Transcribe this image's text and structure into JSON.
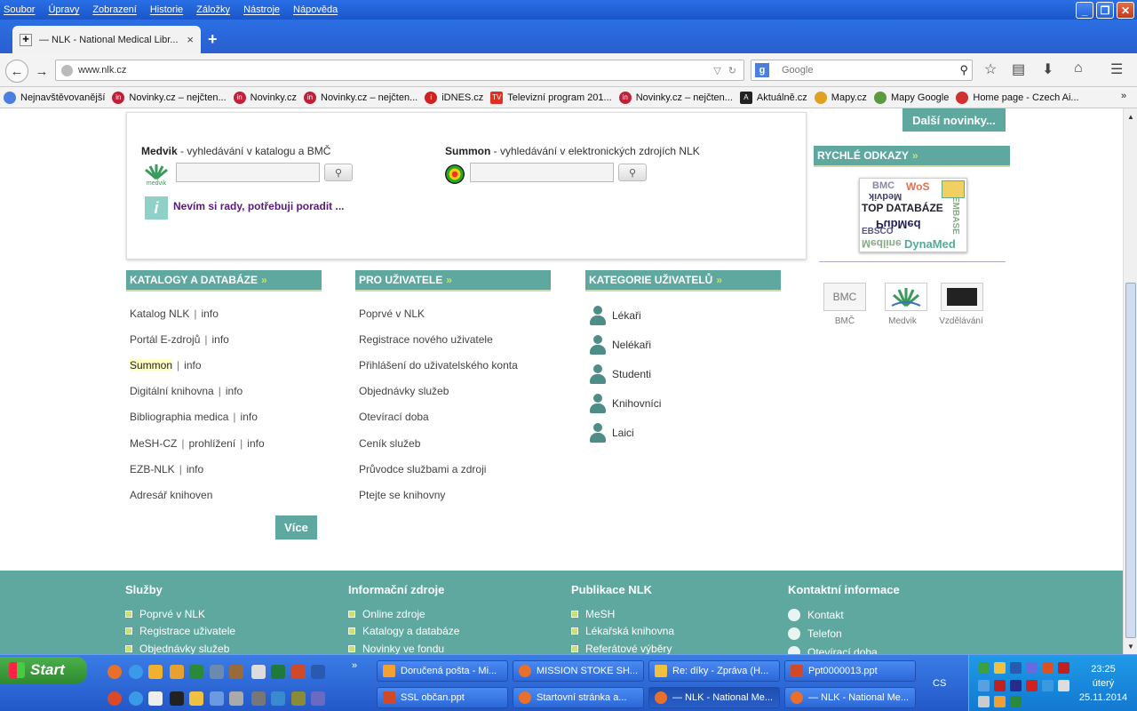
{
  "menu": [
    "Soubor",
    "Úpravy",
    "Zobrazení",
    "Historie",
    "Záložky",
    "Nástroje",
    "Nápověda"
  ],
  "tab": {
    "title": "— NLK - National Medical Libr...",
    "close": "×",
    "new": "+"
  },
  "nav": {
    "url": "www.nlk.cz",
    "search_placeholder": "Google"
  },
  "bookmarks": [
    "Nejnavštěvovanější",
    "Novinky.cz – nejčten...",
    "Novinky.cz",
    "Novinky.cz – nejčten...",
    "iDNES.cz",
    "Televizní program 201...",
    "Novinky.cz – nejčten...",
    "Aktuálně.cz",
    "Mapy.cz",
    "Mapy Google",
    "Home page - Czech Ai..."
  ],
  "search": {
    "medvik_name": "Medvik",
    "medvik_desc": " - vyhledávání v katalogu a BMČ",
    "summon_name": "Summon",
    "summon_desc": " - vyhledávání v elektronických zdrojích NLK",
    "medvik_logo": "medvik",
    "help": "Nevím si rady, potřebuji poradit ..."
  },
  "sidebar": {
    "more_news": "Další novinky...",
    "quick_links": "RYCHLÉ ODKAZY",
    "top_db_words": [
      "BMC",
      "WoS",
      "TOP DATABÁZE",
      "PubMed",
      "Medvik",
      "EBSCO",
      "Medline",
      "DynaMed",
      "EMBASE"
    ],
    "logos": [
      "BMČ",
      "Medvik",
      "Vzdělávání"
    ],
    "bmc_logo_text": "BMC"
  },
  "columns": {
    "catalogs": {
      "title": "KATALOGY A DATABÁZE",
      "items": [
        {
          "a": "Katalog NLK",
          "b": "info"
        },
        {
          "a": "Portál E-zdrojů",
          "b": "info"
        },
        {
          "a": "Summon",
          "b": "info"
        },
        {
          "a": "Digitální knihovna",
          "b": "info"
        },
        {
          "a": "Bibliographia medica",
          "b": "info"
        },
        {
          "a": "MeSH-CZ",
          "b": "prohlížení",
          "c": "info"
        },
        {
          "a": "EZB-NLK",
          "b": "info"
        },
        {
          "a": "Adresář knihoven"
        }
      ],
      "more": "Více"
    },
    "users": {
      "title": "PRO UŽIVATELE",
      "items": [
        "Poprvé v NLK",
        "Registrace nového uživatele",
        "Přihlášení do uživatelského konta",
        "Objednávky služeb",
        "Otevírací doba",
        "Ceník služeb",
        "Průvodce službami a zdroji",
        "Ptejte se knihovny"
      ]
    },
    "categories": {
      "title": "KATEGORIE UŽIVATELŮ",
      "items": [
        "Lékaři",
        "Nelékaři",
        "Studenti",
        "Knihovníci",
        "Laici"
      ]
    }
  },
  "footer": {
    "services": {
      "title": "Služby",
      "items": [
        "Poprvé v NLK",
        "Registrace uživatele",
        "Objednávky služeb"
      ]
    },
    "info": {
      "title": "Informační zdroje",
      "items": [
        "Online zdroje",
        "Katalogy a databáze",
        "Novinky ve fondu"
      ]
    },
    "pubs": {
      "title": "Publikace NLK",
      "items": [
        "MeSH",
        "Lékařská knihovna",
        "Referátové výběry"
      ]
    },
    "contact": {
      "title": "Kontaktní informace",
      "items": [
        "Kontakt",
        "Telefon",
        "Otevírací doba"
      ]
    }
  },
  "taskbar": {
    "start": "Start",
    "buttons_top": [
      "Doručená pošta - Mi...",
      "MISSION STOKE SH...",
      "Re: díky - Zpráva (H...",
      "Ppt0000013.ppt"
    ],
    "buttons_bottom": [
      "SSL občan.ppt",
      "Startovní stránka a...",
      "— NLK - National Me...",
      "— NLK - National Me..."
    ],
    "lang": "CS",
    "time": "23:25",
    "day": "úterý",
    "date": "25.11.2014"
  }
}
